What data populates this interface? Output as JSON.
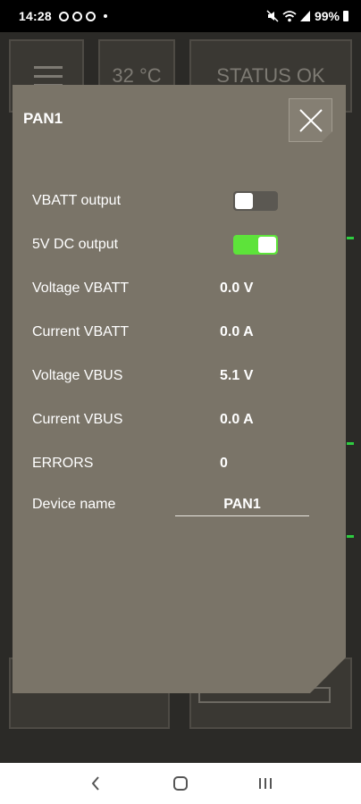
{
  "statusbar": {
    "time": "14:28",
    "battery": "99%",
    "icons": [
      "notification-icon",
      "notification-icon",
      "notification-icon",
      "mute-icon",
      "wifi-icon",
      "signal-icon",
      "battery-icon"
    ]
  },
  "background_app": {
    "temperature": "32 °C",
    "status": "STATUS OK",
    "menu_icon": "hamburger-icon"
  },
  "modal": {
    "title": "PAN1",
    "close_icon": "close-icon",
    "rows": [
      {
        "label": "VBATT output",
        "type": "toggle",
        "on": false
      },
      {
        "label": "5V DC output",
        "type": "toggle",
        "on": true
      },
      {
        "label": "Voltage VBATT",
        "value": "0.0 V"
      },
      {
        "label": "Current VBATT",
        "value": "0.0 A"
      },
      {
        "label": "Voltage VBUS",
        "value": "5.1 V"
      },
      {
        "label": "Current VBUS",
        "value": "0.0 A"
      },
      {
        "label": "ERRORS",
        "value": "0"
      }
    ],
    "device_name": {
      "label": "Device name",
      "value": "PAN1"
    }
  },
  "colors": {
    "modal_bg": "#7a7468",
    "toggle_on": "#5de33a",
    "toggle_off": "#5b5852"
  },
  "navbar": {
    "icons": [
      "back-icon",
      "home-icon",
      "recents-icon"
    ]
  }
}
